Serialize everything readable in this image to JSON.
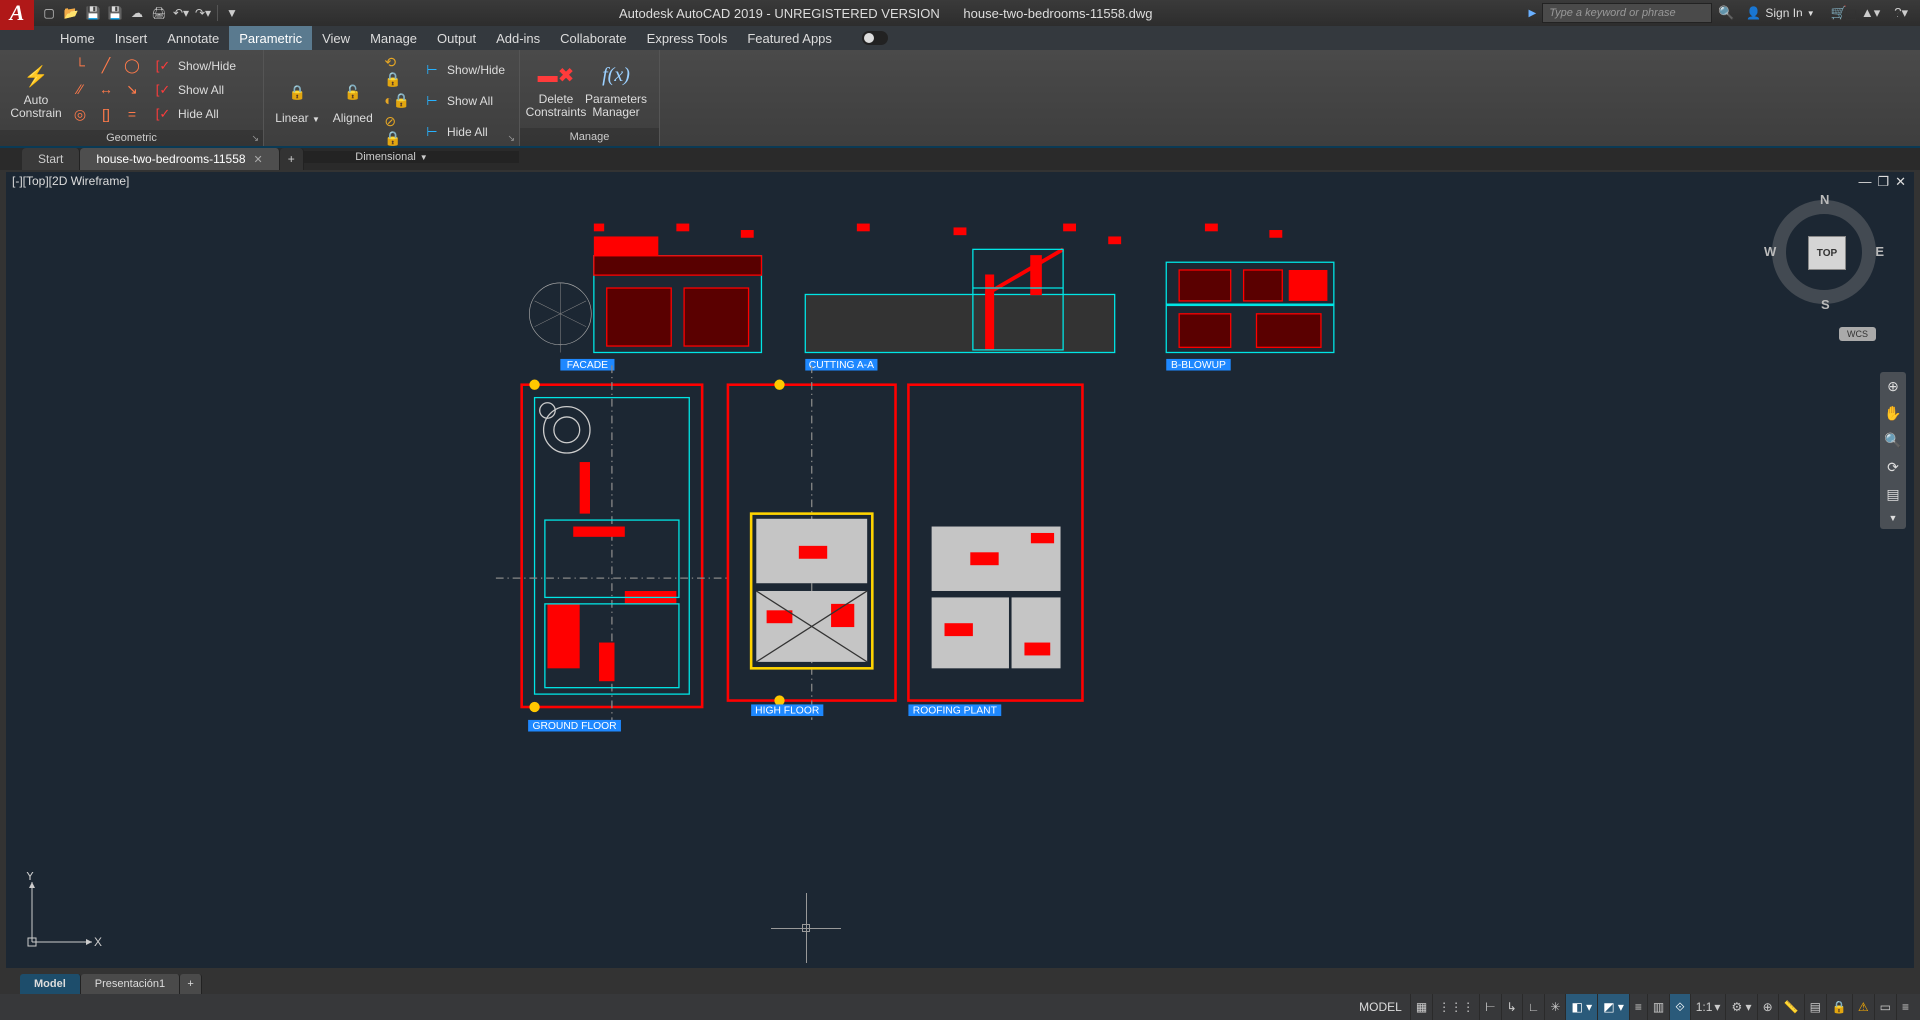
{
  "title": {
    "app": "Autodesk AutoCAD 2019 - UNREGISTERED VERSION",
    "file": "house-two-bedrooms-11558.dwg"
  },
  "search": {
    "placeholder": "Type a keyword or phrase"
  },
  "signin": {
    "label": "Sign In"
  },
  "menu": {
    "items": [
      {
        "label": "Home"
      },
      {
        "label": "Insert"
      },
      {
        "label": "Annotate"
      },
      {
        "label": "Parametric",
        "active": true
      },
      {
        "label": "View"
      },
      {
        "label": "Manage"
      },
      {
        "label": "Output"
      },
      {
        "label": "Add-ins"
      },
      {
        "label": "Collaborate"
      },
      {
        "label": "Express Tools"
      },
      {
        "label": "Featured Apps"
      }
    ]
  },
  "ribbon": {
    "panels": [
      {
        "title": "Geometric"
      },
      {
        "title": "Dimensional"
      },
      {
        "title": "Manage"
      }
    ],
    "auto_constrain": "Auto\nConstrain",
    "show_hide": "Show/Hide",
    "show_all": "Show All",
    "hide_all": "Hide All",
    "linear": "Linear",
    "aligned": "Aligned",
    "delete_constraints": "Delete\nConstraints",
    "parameters_manager": "Parameters\nManager"
  },
  "file_tabs": [
    {
      "label": "Start"
    },
    {
      "label": "house-two-bedrooms-11558",
      "active": true
    }
  ],
  "viewport": {
    "label": "[-][Top][2D Wireframe]"
  },
  "viewcube": {
    "face": "TOP",
    "n": "N",
    "s": "S",
    "e": "E",
    "w": "W",
    "wcs": "WCS"
  },
  "ucs": {
    "x": "X",
    "y": "Y"
  },
  "drawing_labels": {
    "facade": "FACADE",
    "cutting": "CUTTING A-A",
    "blowup": "B-BLOWUP",
    "ground": "GROUND FLOOR",
    "high": "HIGH FLOOR",
    "roof": "ROOFING PLANT"
  },
  "model_tabs": [
    {
      "label": "Model",
      "active": true
    },
    {
      "label": "Presentación1"
    }
  ],
  "statusbar": {
    "model": "MODEL",
    "scale": "1:1",
    "items": [
      {
        "ic": "grid"
      },
      {
        "ic": "snap"
      },
      {
        "ic": "ortho"
      },
      {
        "ic": "polar"
      },
      {
        "ic": "iso",
        "on": true
      },
      {
        "ic": "osnap",
        "on": true
      },
      {
        "ic": "otrack"
      },
      {
        "ic": "lwt",
        "on": true
      },
      {
        "ic": "transp"
      },
      {
        "ic": "cycle"
      }
    ]
  }
}
